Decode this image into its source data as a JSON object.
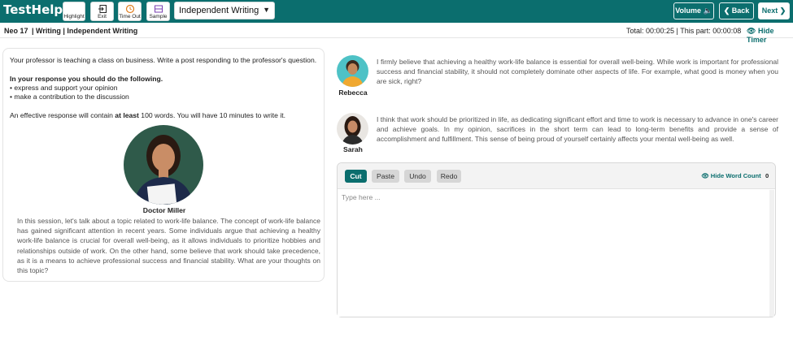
{
  "app": {
    "brand": "TestHelper"
  },
  "toolbar": {
    "highlight": "Highlight",
    "exit": "Exit",
    "timeout": "Time Out",
    "sample": "Sample",
    "task_select": "Independent Writing",
    "volume": "Volume",
    "back": "Back",
    "next": "Next"
  },
  "subbar": {
    "test_id": "Neo 17",
    "section": "| Writing | Independent Writing",
    "timer": "Total: 00:00:25 | This part: 00:00:08",
    "hide_timer": "Hide Timer"
  },
  "prompt": {
    "intro": "Your professor is teaching a class on business. Write a post responding to the professor's question.",
    "instructions_heading": "In your response you should do the following.",
    "bullets": [
      "• express and support your opinion",
      "• make a contribution to the discussion"
    ],
    "effective_pre": "An effective response will contain ",
    "effective_bold": "at least",
    "effective_post": " 100 words. You will have 10 minutes to write it."
  },
  "professor": {
    "name": "Doctor Miller",
    "text": "In this session, let's talk about a topic related to work-life balance. The concept of work-life balance has gained significant attention in recent years. Some individuals argue that achieving a healthy work-life balance is crucial for overall well-being, as it allows individuals to prioritize hobbies and relationships outside of work. On the other hand, some believe that work should take precedence, as it is a means to achieve professional success and financial stability. What are your thoughts on this topic?"
  },
  "students": [
    {
      "name": "Rebecca",
      "text": "I firmly believe that achieving a healthy work-life balance is essential for overall well-being. While work is important for professional success and financial stability, it should not completely dominate other aspects of life. For example, what good is money when you are sick, right?"
    },
    {
      "name": "Sarah",
      "text": "I think that work should be prioritized in life, as dedicating significant effort and time to work is necessary to advance in one's career and achieve goals. In my opinion, sacrifices in the short term can lead to long-term benefits and provide a sense of accomplishment and fulfillment. This sense of being proud of yourself certainly affects your mental well-being as well."
    }
  ],
  "editor": {
    "cut": "Cut",
    "paste": "Paste",
    "undo": "Undo",
    "redo": "Redo",
    "hide_word_count": "Hide Word Count",
    "word_count": "0",
    "placeholder": "Type here ..."
  },
  "colors": {
    "accent": "#0b6e6e"
  }
}
